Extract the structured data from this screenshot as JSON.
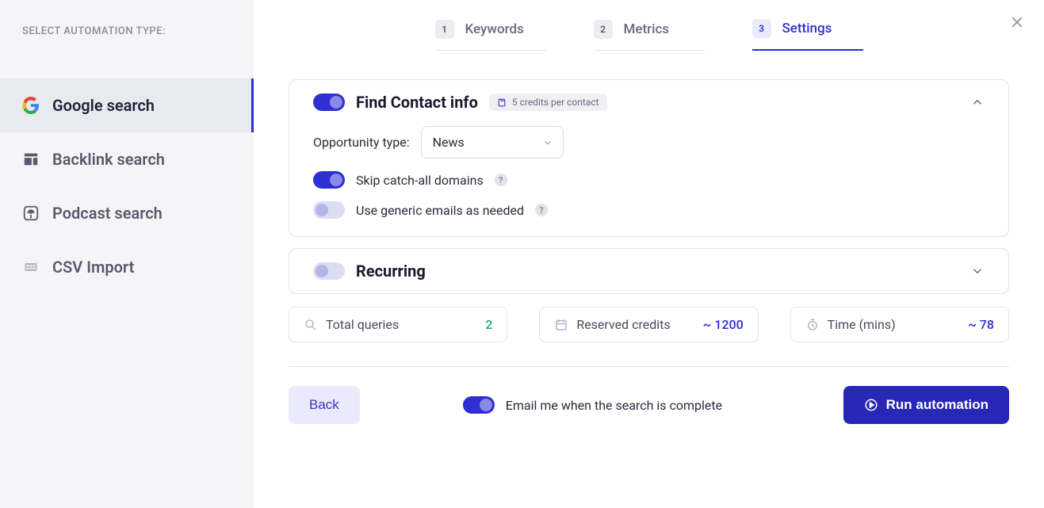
{
  "sidebar": {
    "title": "SELECT AUTOMATION TYPE:",
    "items": [
      {
        "label": "Google search"
      },
      {
        "label": "Backlink search"
      },
      {
        "label": "Podcast search"
      },
      {
        "label": "CSV Import"
      }
    ]
  },
  "steps": [
    {
      "num": "1",
      "label": "Keywords"
    },
    {
      "num": "2",
      "label": "Metrics"
    },
    {
      "num": "3",
      "label": "Settings"
    }
  ],
  "find_contact": {
    "title": "Find Contact info",
    "badge": "5 credits per contact",
    "opportunity_label": "Opportunity type:",
    "opportunity_value": "News",
    "skip_label": "Skip catch-all domains",
    "generic_label": "Use generic emails as needed"
  },
  "recurring": {
    "title": "Recurring"
  },
  "stats": {
    "queries_label": "Total queries",
    "queries_value": "2",
    "credits_label": "Reserved credits",
    "credits_value": "~ 1200",
    "time_label": "Time (mins)",
    "time_value": "~ 78"
  },
  "footer": {
    "back_label": "Back",
    "email_label": "Email me when the search is complete",
    "run_label": "Run automation"
  }
}
